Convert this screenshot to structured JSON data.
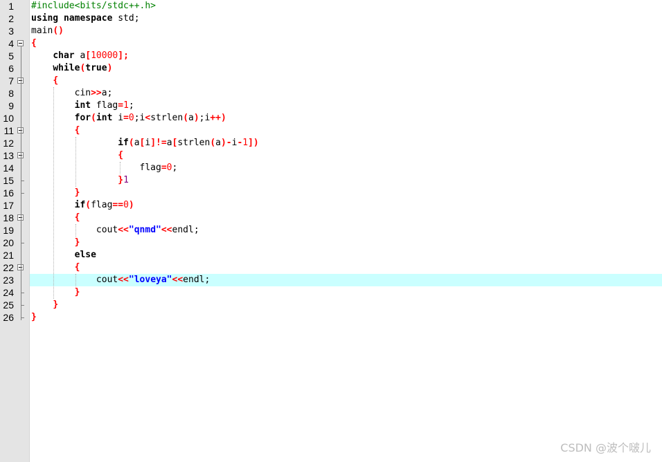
{
  "editor": {
    "line_numbers": [
      "1",
      "2",
      "3",
      "4",
      "5",
      "6",
      "7",
      "8",
      "9",
      "10",
      "11",
      "12",
      "13",
      "14",
      "15",
      "16",
      "17",
      "18",
      "19",
      "20",
      "21",
      "22",
      "23",
      "24",
      "25",
      "26"
    ],
    "highlighted_line": 23,
    "lines": [
      [
        {
          "t": "pp",
          "v": "#include<bits/stdc++.h>"
        }
      ],
      [
        {
          "t": "kw",
          "v": "using namespace"
        },
        {
          "t": "id",
          "v": " std;"
        }
      ],
      [
        {
          "t": "id",
          "v": "main"
        },
        {
          "t": "op",
          "v": "()"
        }
      ],
      [
        {
          "t": "op",
          "v": "{"
        }
      ],
      [
        {
          "t": "id",
          "v": "    "
        },
        {
          "t": "kw",
          "v": "char"
        },
        {
          "t": "id",
          "v": " a"
        },
        {
          "t": "op",
          "v": "["
        },
        {
          "t": "num",
          "v": "10000"
        },
        {
          "t": "op",
          "v": "];"
        }
      ],
      [
        {
          "t": "id",
          "v": "    "
        },
        {
          "t": "kw",
          "v": "while"
        },
        {
          "t": "op",
          "v": "("
        },
        {
          "t": "kw",
          "v": "true"
        },
        {
          "t": "op",
          "v": ")"
        }
      ],
      [
        {
          "t": "id",
          "v": "    "
        },
        {
          "t": "op",
          "v": "{"
        }
      ],
      [
        {
          "t": "id",
          "v": "        cin"
        },
        {
          "t": "op",
          "v": ">>"
        },
        {
          "t": "id",
          "v": "a;"
        }
      ],
      [
        {
          "t": "id",
          "v": "        "
        },
        {
          "t": "kw",
          "v": "int"
        },
        {
          "t": "id",
          "v": " flag"
        },
        {
          "t": "op",
          "v": "="
        },
        {
          "t": "num",
          "v": "1"
        },
        {
          "t": "id",
          "v": ";"
        }
      ],
      [
        {
          "t": "id",
          "v": "        "
        },
        {
          "t": "kw",
          "v": "for"
        },
        {
          "t": "op",
          "v": "("
        },
        {
          "t": "kw",
          "v": "int"
        },
        {
          "t": "id",
          "v": " i"
        },
        {
          "t": "op",
          "v": "="
        },
        {
          "t": "num",
          "v": "0"
        },
        {
          "t": "id",
          "v": ";i"
        },
        {
          "t": "op",
          "v": "<"
        },
        {
          "t": "id",
          "v": "strlen"
        },
        {
          "t": "op",
          "v": "("
        },
        {
          "t": "id",
          "v": "a"
        },
        {
          "t": "op",
          "v": ")"
        },
        {
          "t": "id",
          "v": ";i"
        },
        {
          "t": "op",
          "v": "++)"
        }
      ],
      [
        {
          "t": "id",
          "v": "        "
        },
        {
          "t": "op",
          "v": "{"
        }
      ],
      [
        {
          "t": "id",
          "v": "                "
        },
        {
          "t": "kw",
          "v": "if"
        },
        {
          "t": "op",
          "v": "("
        },
        {
          "t": "id",
          "v": "a"
        },
        {
          "t": "op",
          "v": "["
        },
        {
          "t": "id",
          "v": "i"
        },
        {
          "t": "op",
          "v": "]!="
        },
        {
          "t": "id",
          "v": "a"
        },
        {
          "t": "op",
          "v": "["
        },
        {
          "t": "id",
          "v": "strlen"
        },
        {
          "t": "op",
          "v": "("
        },
        {
          "t": "id",
          "v": "a"
        },
        {
          "t": "op",
          "v": ")-"
        },
        {
          "t": "id",
          "v": "i"
        },
        {
          "t": "op",
          "v": "-"
        },
        {
          "t": "num",
          "v": "1"
        },
        {
          "t": "op",
          "v": "])"
        }
      ],
      [
        {
          "t": "id",
          "v": "                "
        },
        {
          "t": "op",
          "v": "{"
        }
      ],
      [
        {
          "t": "id",
          "v": "                    flag"
        },
        {
          "t": "op",
          "v": "="
        },
        {
          "t": "num",
          "v": "0"
        },
        {
          "t": "id",
          "v": ";"
        }
      ],
      [
        {
          "t": "id",
          "v": "                "
        },
        {
          "t": "op",
          "v": "}"
        },
        {
          "t": "stray",
          "v": "1"
        }
      ],
      [
        {
          "t": "id",
          "v": "        "
        },
        {
          "t": "op",
          "v": "}"
        }
      ],
      [
        {
          "t": "id",
          "v": "        "
        },
        {
          "t": "kw",
          "v": "if"
        },
        {
          "t": "op",
          "v": "("
        },
        {
          "t": "id",
          "v": "flag"
        },
        {
          "t": "op",
          "v": "=="
        },
        {
          "t": "num",
          "v": "0"
        },
        {
          "t": "op",
          "v": ")"
        }
      ],
      [
        {
          "t": "id",
          "v": "        "
        },
        {
          "t": "op",
          "v": "{"
        }
      ],
      [
        {
          "t": "id",
          "v": "            cout"
        },
        {
          "t": "op",
          "v": "<<"
        },
        {
          "t": "str",
          "v": "\"qnmd\""
        },
        {
          "t": "op",
          "v": "<<"
        },
        {
          "t": "id",
          "v": "endl;"
        }
      ],
      [
        {
          "t": "id",
          "v": "        "
        },
        {
          "t": "op",
          "v": "}"
        }
      ],
      [
        {
          "t": "id",
          "v": "        "
        },
        {
          "t": "kw",
          "v": "else"
        }
      ],
      [
        {
          "t": "id",
          "v": "        "
        },
        {
          "t": "op",
          "v": "{"
        }
      ],
      [
        {
          "t": "id",
          "v": "            cout"
        },
        {
          "t": "op",
          "v": "<<"
        },
        {
          "t": "str",
          "v": "\"loveya\""
        },
        {
          "t": "op",
          "v": "<<"
        },
        {
          "t": "id",
          "v": "endl;"
        }
      ],
      [
        {
          "t": "id",
          "v": "        "
        },
        {
          "t": "op",
          "v": "}"
        }
      ],
      [
        {
          "t": "id",
          "v": "    "
        },
        {
          "t": "op",
          "v": "}"
        }
      ],
      [
        {
          "t": "op",
          "v": "}"
        }
      ]
    ]
  },
  "watermark": "CSDN @波个啵儿"
}
